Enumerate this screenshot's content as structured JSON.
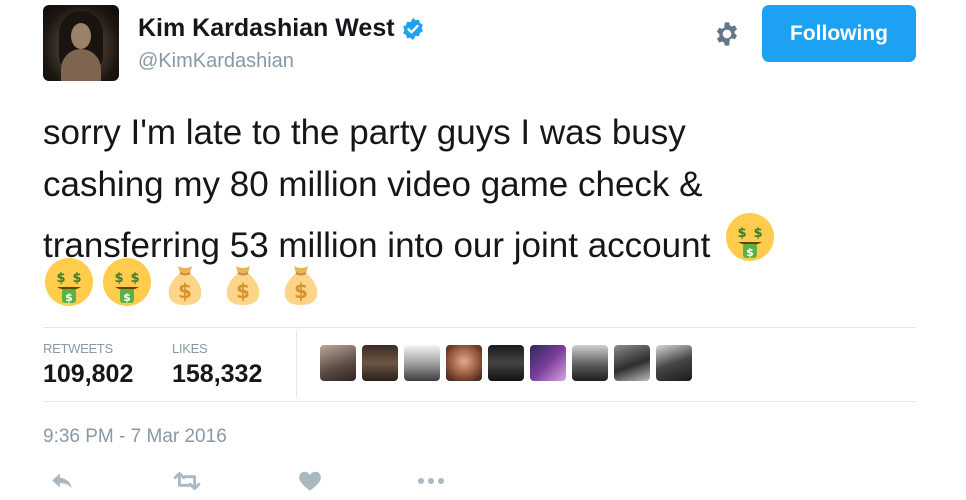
{
  "user": {
    "name": "Kim Kardashian West",
    "handle": "@KimKardashian"
  },
  "follow_button": {
    "label": "Following"
  },
  "tweet": {
    "text_lines": [
      "sorry I'm late to the party guys I was busy",
      "cashing my 80 million video game check &",
      "transferring 53 million into our joint account"
    ],
    "emoji_row": [
      "money-mouth-face",
      "money-mouth-face",
      "money-bag",
      "money-bag",
      "money-bag"
    ]
  },
  "stats": {
    "retweets_label": "RETWEETS",
    "retweets_value": "109,802",
    "likes_label": "LIKES",
    "likes_value": "158,332"
  },
  "liker_avatar_count": 9,
  "timestamp": "9:36 PM - 7 Mar 2016",
  "colors": {
    "accent": "#1da1f2",
    "muted": "#8899a6",
    "text": "#14171a",
    "divider": "#e1e8ed"
  }
}
